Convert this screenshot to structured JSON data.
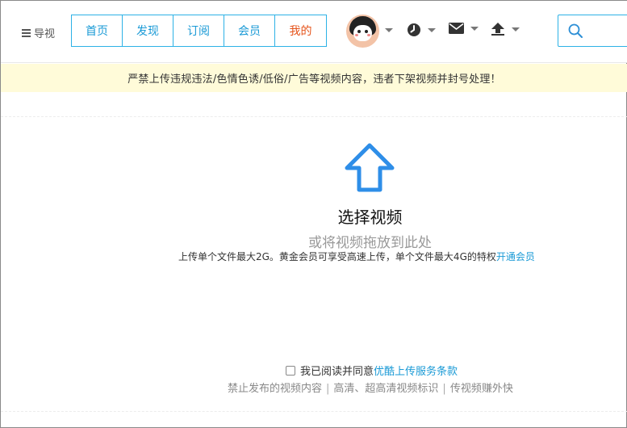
{
  "header": {
    "guide_label": "导视",
    "nav_tabs": [
      {
        "label": "首页"
      },
      {
        "label": "发现"
      },
      {
        "label": "订阅"
      },
      {
        "label": "会员"
      },
      {
        "label": "我的"
      }
    ],
    "active_tab": "我的",
    "search": {
      "placeholder": ""
    }
  },
  "notice": {
    "text": "严禁上传违规违法/色情色诱/低俗/广告等视频内容，违者下架视频并封号处理！"
  },
  "upload": {
    "title": "选择视频",
    "subtitle": "或将视频拖放到此处",
    "limit_text": "上传单个文件最大2G。黄金会员可享受高速上传，单个文件最大4G的特权",
    "limit_link": "开通会员"
  },
  "agreement": {
    "label": "我已阅读并同意",
    "link": "优酷上传服务条款"
  },
  "rules": {
    "items": [
      "禁止发布的视频内容",
      "高清、超高清视频标识",
      "传视频赚外快"
    ],
    "separator": "|"
  },
  "colors": {
    "accent": "#1a9ad6",
    "nav_border": "#2db2e6",
    "active": "#e5531a",
    "notice_bg": "#fffbd9",
    "upload_icon": "#2e8ee8"
  }
}
